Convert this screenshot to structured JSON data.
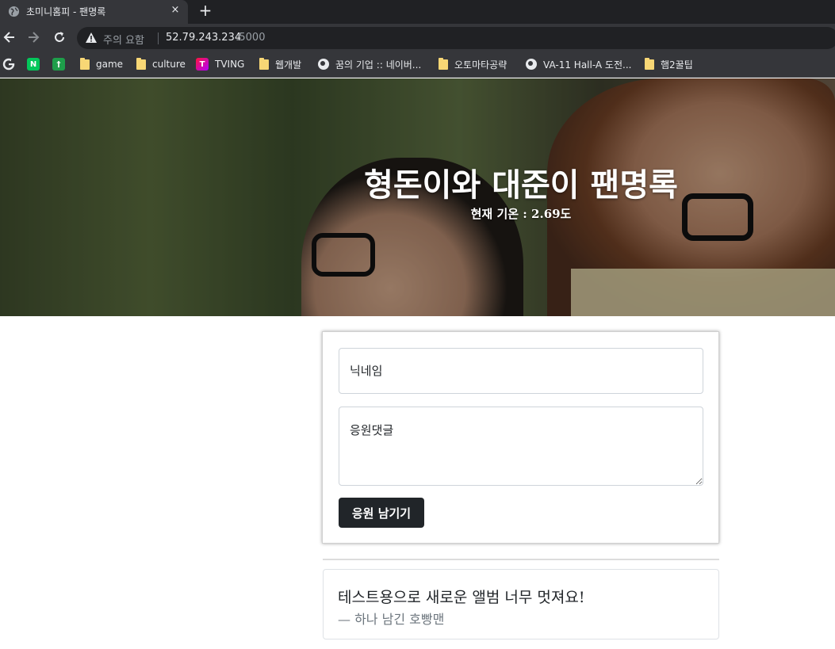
{
  "browser": {
    "tab_title": "초미니홈피 - 팬명록",
    "tab_close": "×",
    "new_tab": "+",
    "security_label": "주의 요함",
    "url_host": "52.79.243.234",
    "url_port": ":5000",
    "bookmarks": [
      {
        "icon": "google-icon",
        "label": ""
      },
      {
        "icon": "naver-icon",
        "label": ""
      },
      {
        "icon": "plus-app-icon",
        "label": ""
      },
      {
        "icon": "folder-icon",
        "label": "game"
      },
      {
        "icon": "folder-icon",
        "label": "culture"
      },
      {
        "icon": "tving-icon",
        "label": "TVING"
      },
      {
        "icon": "folder-icon",
        "label": "웹개발"
      },
      {
        "icon": "globe-icon",
        "label": "꿈의 기업 :: 네이버..."
      },
      {
        "icon": "folder-icon",
        "label": "오토마타공략"
      },
      {
        "icon": "globe-icon",
        "label": "VA-11 Hall-A 도전..."
      },
      {
        "icon": "folder-icon",
        "label": "햄2꿀팁"
      }
    ]
  },
  "hero": {
    "title": "형돈이와 대준이 팬명록",
    "subtitle": "현재 기온 : 2.69도"
  },
  "form": {
    "name_placeholder": "닉네임",
    "comment_placeholder": "응원댓글",
    "submit_label": "응원 남기기"
  },
  "comments": [
    {
      "text": "테스트용으로 새로운 앨범 너무 멋져요!",
      "author": "— 하나 남긴 호빵맨"
    }
  ],
  "colors": {
    "chrome_dark": "#202124",
    "chrome_toolbar": "#35363a",
    "button_dark": "#212529",
    "muted_text": "#6c757d"
  }
}
